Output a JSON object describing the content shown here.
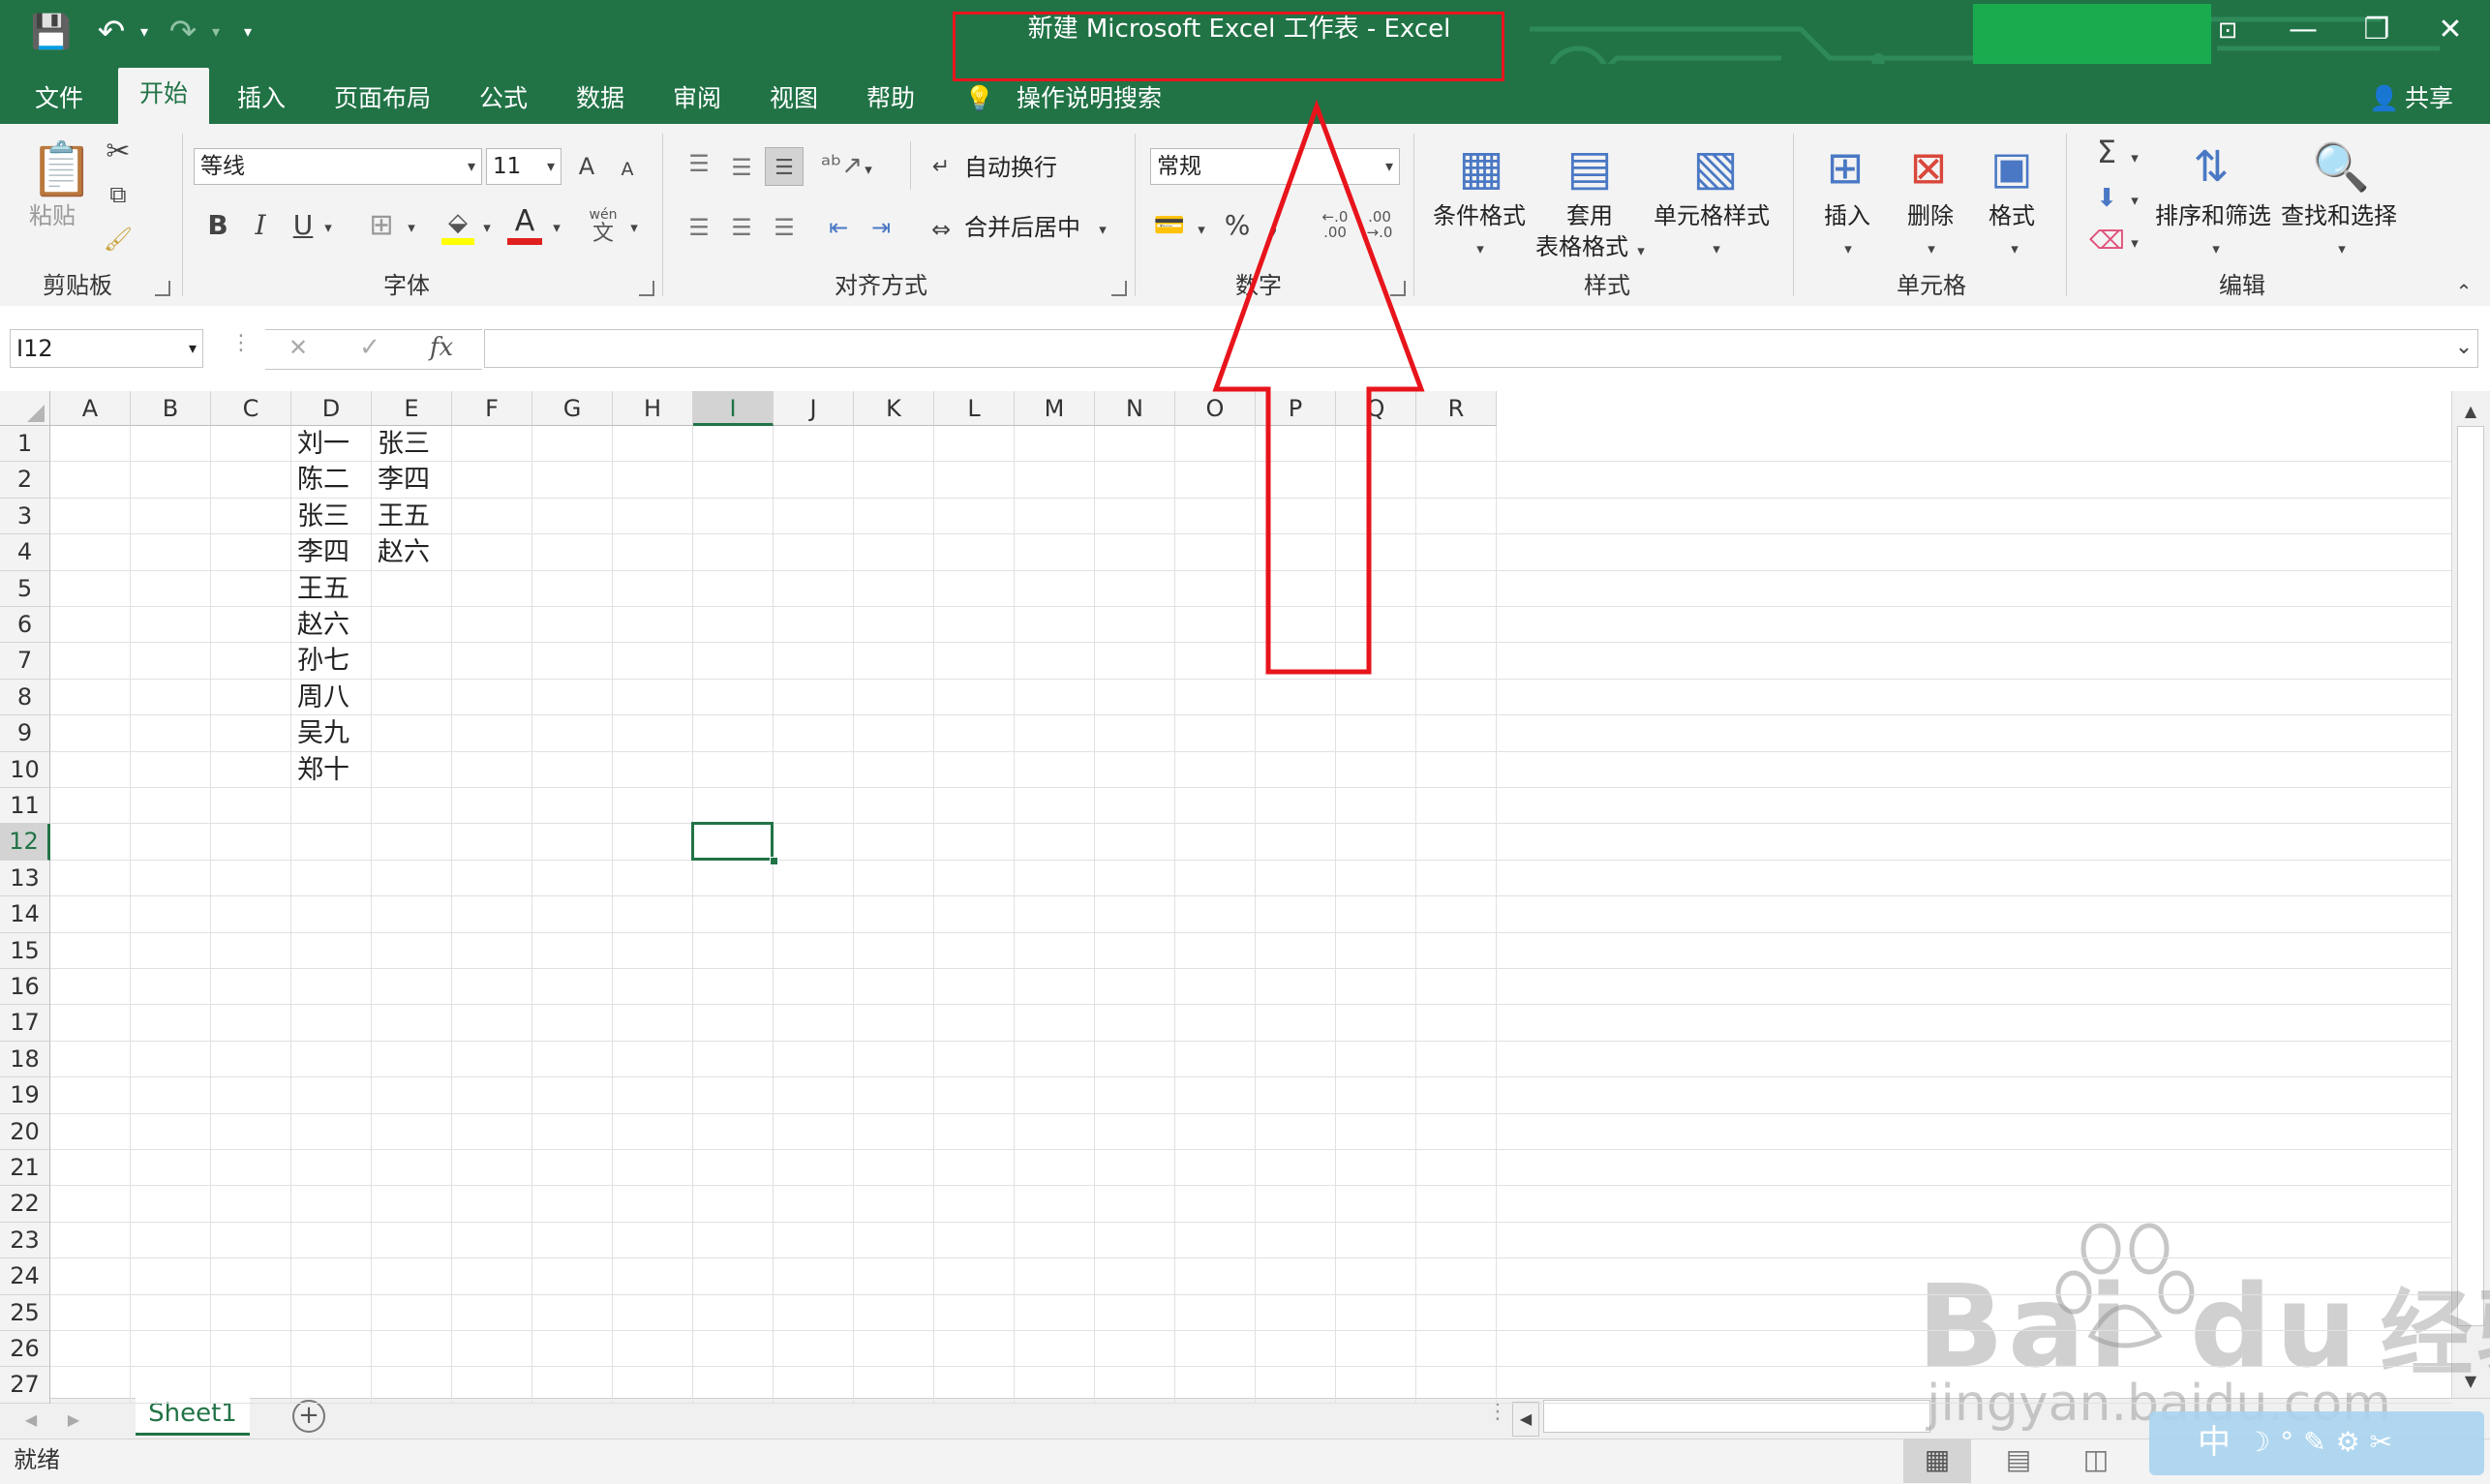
{
  "window": {
    "title": "新建 Microsoft Excel 工作表  -  Excel",
    "share_label": "共享",
    "user_icon": "person-icon"
  },
  "tabs": [
    "文件",
    "开始",
    "插入",
    "页面布局",
    "公式",
    "数据",
    "审阅",
    "视图",
    "帮助"
  ],
  "tell_me": "操作说明搜索",
  "ribbon": {
    "clipboard": {
      "paste": "粘贴",
      "group": "剪贴板"
    },
    "font": {
      "name": "等线",
      "size": "11",
      "grow": "A",
      "shrink": "A",
      "bold": "B",
      "italic": "I",
      "underline": "U",
      "font_color": "A",
      "phonetic": "wén",
      "group": "字体"
    },
    "alignment": {
      "wrap": "自动换行",
      "merge": "合并后居中",
      "group": "对齐方式"
    },
    "number": {
      "format": "常规",
      "percent": "%",
      "comma": ",",
      "group": "数字"
    },
    "styles": {
      "conditional": "条件格式",
      "table_line1": "套用",
      "table_line2": "表格格式",
      "cell_styles": "单元格样式",
      "group": "样式"
    },
    "cells": {
      "insert": "插入",
      "delete": "删除",
      "format": "格式",
      "group": "单元格"
    },
    "editing": {
      "sum": "Σ",
      "sort": "排序和筛选",
      "find": "查找和选择",
      "group": "编辑"
    }
  },
  "formula_bar": {
    "name_box": "I12",
    "fx": "fx",
    "cancel": "✕",
    "enter": "✓",
    "value": ""
  },
  "columns": [
    "A",
    "B",
    "C",
    "D",
    "E",
    "F",
    "G",
    "H",
    "I",
    "J",
    "K",
    "L",
    "M",
    "N",
    "O",
    "P",
    "Q",
    "R"
  ],
  "rows": [
    "1",
    "2",
    "3",
    "4",
    "5",
    "6",
    "7",
    "8",
    "9",
    "10",
    "11",
    "12",
    "13",
    "14",
    "15",
    "16",
    "17",
    "18",
    "19",
    "20",
    "21",
    "22",
    "23",
    "24",
    "25",
    "26",
    "27"
  ],
  "cells": {
    "D": [
      "刘一",
      "陈二",
      "张三",
      "李四",
      "王五",
      "赵六",
      "孙七",
      "周八",
      "吴九",
      "郑十"
    ],
    "E": [
      "张三",
      "李四",
      "王五",
      "赵六"
    ]
  },
  "selected_cell": "I12",
  "sheet": {
    "name": "Sheet1",
    "add": "+"
  },
  "status": {
    "ready": "就绪"
  },
  "watermark": {
    "brand": "Bai",
    "brand2": "du",
    "cn": "经验",
    "url": "jingyan.baidu.com"
  },
  "ime": {
    "label": "中"
  },
  "annotation_color": "#e8141c",
  "accent_color": "#217346"
}
